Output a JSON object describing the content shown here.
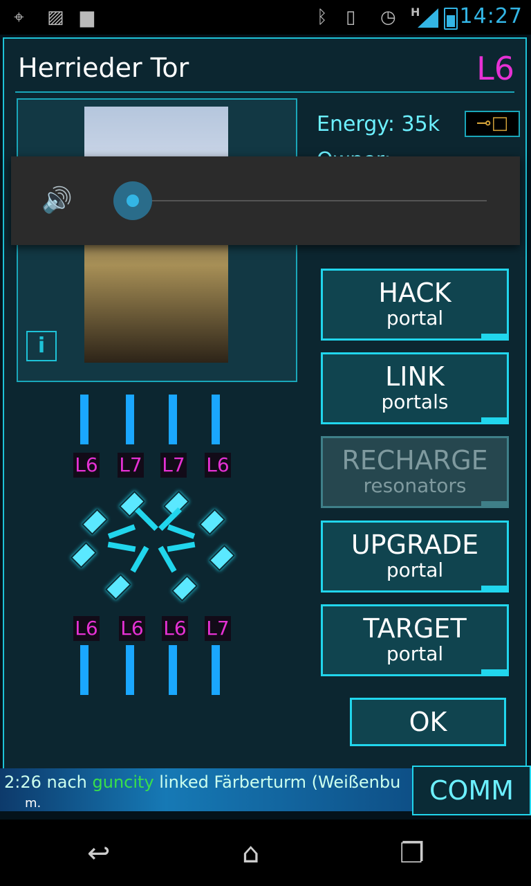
{
  "status_bar": {
    "time": "14:27",
    "network_type": "H",
    "icons": [
      "gps-icon",
      "image-icon",
      "chat-icon",
      "bluetooth-icon",
      "vibrate-icon",
      "alarm-icon",
      "signal-icon",
      "battery-icon"
    ]
  },
  "portal": {
    "name": "Herrieder Tor",
    "level": "L6",
    "energy_label": "Energy:",
    "energy_value": "35k",
    "owner_label": "Owner:",
    "info_label": "i"
  },
  "actions": [
    {
      "line1": "HACK",
      "line2": "portal",
      "enabled": true
    },
    {
      "line1": "LINK",
      "line2": "portals",
      "enabled": true
    },
    {
      "line1": "RECHARGE",
      "line2": "resonators",
      "enabled": false
    },
    {
      "line1": "UPGRADE",
      "line2": "portal",
      "enabled": true
    },
    {
      "line1": "TARGET",
      "line2": "portal",
      "enabled": true
    }
  ],
  "ok_label": "OK",
  "resonators": {
    "top": [
      "L6",
      "L7",
      "L7",
      "L6"
    ],
    "bottom": [
      "L6",
      "L6",
      "L6",
      "L7"
    ]
  },
  "comm": {
    "button": "COMM",
    "line_time": "2:26",
    "line_prefix": "nach",
    "line_agent": "guncity",
    "line_text": "linked Färberturm (Weißenbu",
    "line2": "m."
  },
  "volume": {
    "level_percent": 0
  },
  "colors": {
    "accent": "#21d6ed",
    "level_magenta": "#e631d4",
    "energy_text": "#6cf0ff"
  }
}
